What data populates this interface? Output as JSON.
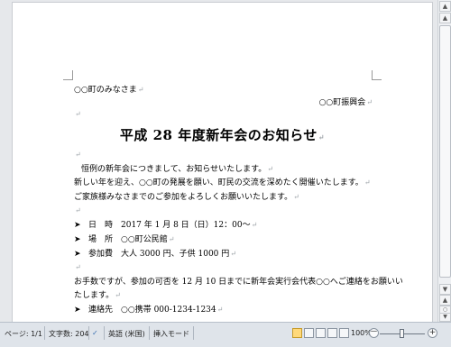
{
  "document": {
    "addressee": "○○町のみなさま",
    "sender": "○○町振興会",
    "title": "平成 28 年度新年会のお知らせ",
    "body": [
      "恒例の新年会につきまして、お知らせいたします。",
      "新しい年を迎え、○○町の発展を願い、町民の交流を深めたく開催いたします。",
      "ご家族様みなさまでのご参加をよろしくお願いいたします。"
    ],
    "items": [
      "日　時　2017 年 1 月 8 日（日）12：00～",
      "場　所　○○町公民館",
      "参加費　大人 3000 円、子供 1000 円"
    ],
    "closing": [
      "お手数ですが、参加の可否を 12 月 10 日までに新年会実行会代表○○へご連絡をお願いい",
      "たします。"
    ],
    "contact": "連絡先　○○携帯 000-1234-1234",
    "para_mark": "↵",
    "bullet": "➤"
  },
  "scrollbar": {
    "up": "▲",
    "down": "▼",
    "prev_page": "▲",
    "next_page": "▼",
    "browse": "○"
  },
  "status_bar": {
    "page": "ページ: 1/1",
    "word_count": "文字数: 204",
    "language": "英語 (米国)",
    "insert_mode": "挿入モード",
    "zoom": "100%",
    "zoom_minus": "－",
    "zoom_plus": "+"
  }
}
